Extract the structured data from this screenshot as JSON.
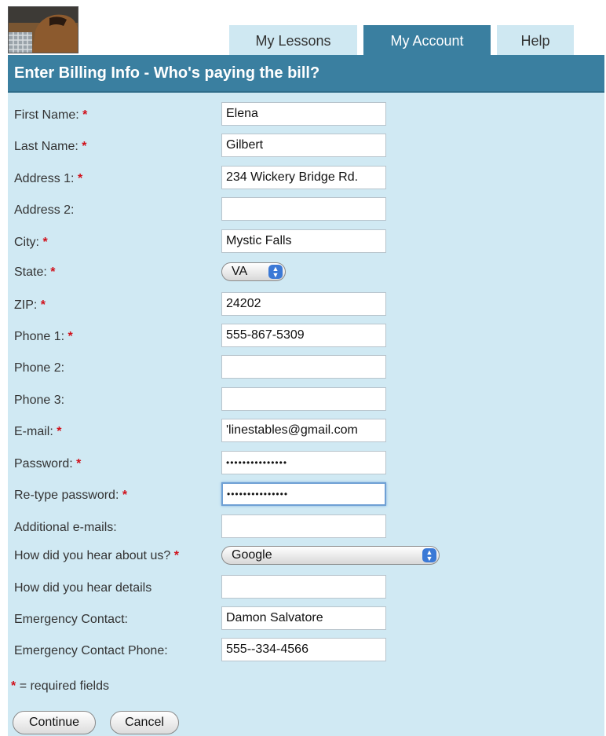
{
  "nav": {
    "tabs": [
      {
        "label": "My Lessons",
        "active": false
      },
      {
        "label": "My Account",
        "active": true
      },
      {
        "label": "Help",
        "active": false
      }
    ]
  },
  "form": {
    "title": "Enter Billing Info - Who's paying the bill?",
    "required_mark": "*",
    "fields": [
      {
        "label": "First Name:",
        "value": "Elena",
        "required": true
      },
      {
        "label": "Last Name:",
        "value": "Gilbert",
        "required": true
      },
      {
        "label": "Address 1:",
        "value": "234 Wickery Bridge Rd.",
        "required": true
      },
      {
        "label": "Address 2:",
        "value": "",
        "required": false
      },
      {
        "label": "City:",
        "value": "Mystic Falls",
        "required": true
      },
      {
        "label": "State:",
        "value": "VA",
        "required": true
      },
      {
        "label": "ZIP:",
        "value": "24202",
        "required": true
      },
      {
        "label": "Phone 1:",
        "value": "555-867-5309",
        "required": true
      },
      {
        "label": "Phone 2:",
        "value": "",
        "required": false
      },
      {
        "label": "Phone 3:",
        "value": "",
        "required": false
      },
      {
        "label": "E-mail:",
        "value": "'linestables@gmail.com",
        "required": true
      },
      {
        "label": "Password:",
        "value": "•••••••••••••••",
        "required": true
      },
      {
        "label": "Re-type password:",
        "value": "•••••••••••••••",
        "required": true
      },
      {
        "label": "Additional e-mails:",
        "value": "",
        "required": false
      },
      {
        "label": "How did you hear about us?",
        "value": "Google",
        "required": true
      },
      {
        "label": "How did you hear details",
        "value": "",
        "required": false
      },
      {
        "label": "Emergency Contact:",
        "value": "Damon Salvatore",
        "required": false
      },
      {
        "label": "Emergency Contact Phone:",
        "value": "555--334-4566",
        "required": false
      }
    ],
    "required_note": "= required fields",
    "continue_label": "Continue",
    "cancel_label": "Cancel"
  },
  "colors": {
    "header_bg": "#3a7fa0",
    "panel_bg": "#d0e9f3",
    "tab_bg": "#cfe8f2",
    "required": "#d0101a"
  },
  "icons": {
    "logo": "horse-logo",
    "select_arrows": "updown-arrows-icon"
  }
}
